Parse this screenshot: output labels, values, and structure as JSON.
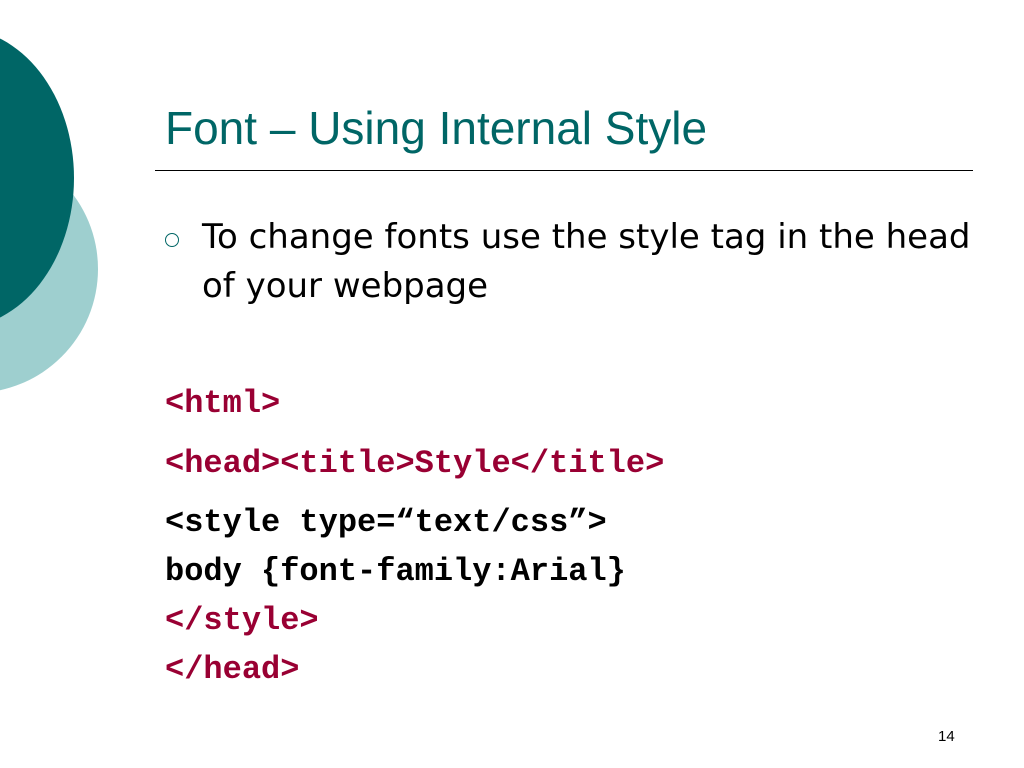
{
  "slide": {
    "title": "Font – Using Internal Style",
    "bullet": "To change fonts use the style tag in the head of your webpage",
    "code_lines": [
      "<html>",
      "<head><title>Style</title>",
      "<style type=“text/css”>",
      "body {font-family:Arial}",
      "</style>",
      "</head>"
    ],
    "page_number": "14"
  },
  "colors": {
    "title": "#006666",
    "code_tag": "#990033",
    "code_text": "#000000",
    "circle_dark": "#006666",
    "circle_light": "#9ecfcf"
  }
}
